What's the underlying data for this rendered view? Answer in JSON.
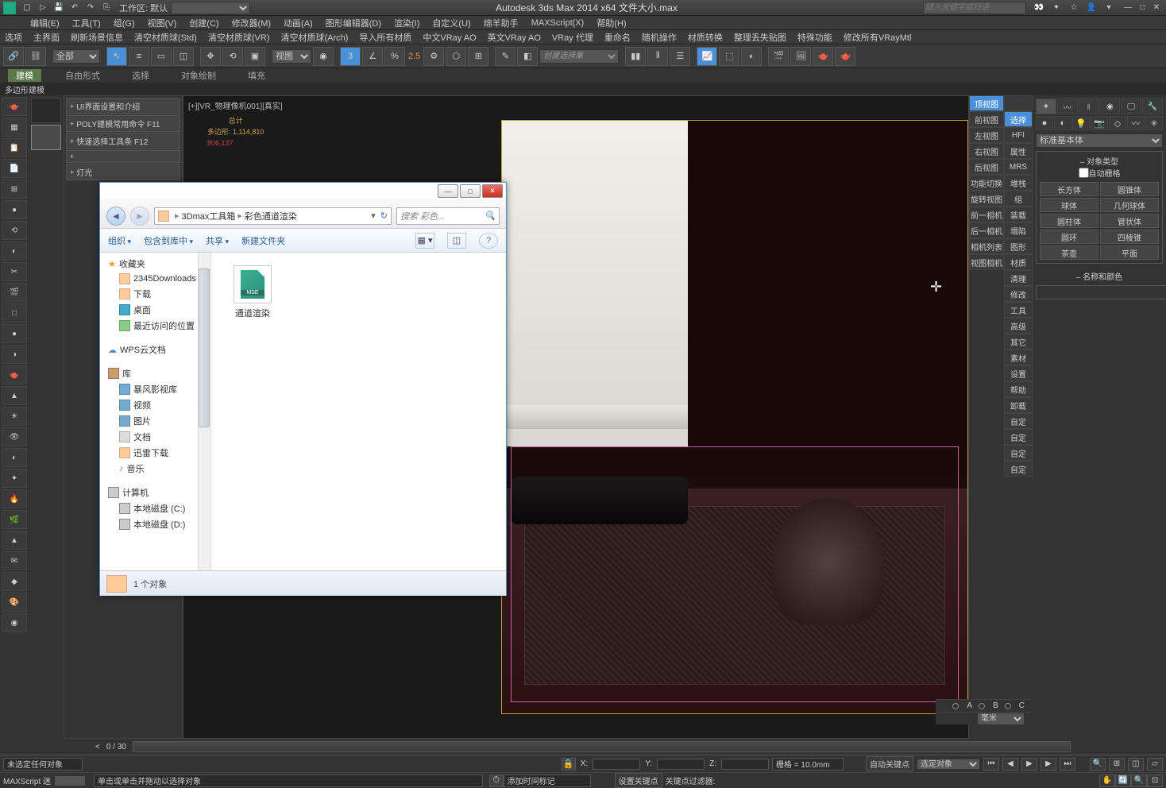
{
  "titlebar": {
    "workspace_label": "工作区: 默认",
    "app_title": "Autodesk 3ds Max  2014 x64   文件大小.max",
    "search_placeholder": "键入关键字或短语"
  },
  "menubar": [
    "编辑(E)",
    "工具(T)",
    "组(G)",
    "视图(V)",
    "创建(C)",
    "修改器(M)",
    "动画(A)",
    "图形编辑器(D)",
    "渲染(I)",
    "自定义(U)",
    "绵羊助手",
    "MAXScript(X)",
    "帮助(H)"
  ],
  "menubar2": [
    "选项",
    "主界面",
    "刷新场景信息",
    "清空材质球(Std)",
    "清空材质球(VR)",
    "清空材质球(Arch)",
    "导入所有材质",
    "中文VRay AO",
    "英文VRay AO",
    "VRay 代理",
    "重命名",
    "随机操作",
    "材质转换",
    "整理丢失贴图",
    "特殊功能",
    "修改所有VRayMtl"
  ],
  "toolbar": {
    "scope": "全部",
    "view_label": "视图",
    "num_label": "2.5",
    "create_set": "创建选择集"
  },
  "tabs": {
    "active": "建模",
    "items": [
      "建模",
      "自由形式",
      "选择",
      "对象绘制",
      "填充"
    ]
  },
  "subtab": "多边形建模",
  "command_buttons": [
    "UI界面设置和介绍",
    "POLY建模常用命令 F11",
    "快速选择工具条 F12",
    "",
    "灯光"
  ],
  "viewport": {
    "label": "[+][VR_物理像机001][真实]",
    "stats_title": "总计",
    "poly_label": "多边形:",
    "poly_count": "1,114,810",
    "vert_count": "806,137"
  },
  "right_labels": [
    {
      "main": "顶视图",
      "sub": ""
    },
    {
      "main": "前视图",
      "sub": "选择"
    },
    {
      "main": "左视图",
      "sub": "HFI"
    },
    {
      "main": "右视图",
      "sub": "属性"
    },
    {
      "main": "后视图",
      "sub": "MRS"
    },
    {
      "main": "功能切换",
      "sub": "堆栈"
    },
    {
      "main": "旋转视图",
      "sub": "组"
    },
    {
      "main": "前一相机",
      "sub": "装载"
    },
    {
      "main": "后一相机",
      "sub": "塌陷"
    },
    {
      "main": "相机列表",
      "sub": "图形"
    },
    {
      "main": "视图相机",
      "sub": "材质"
    }
  ],
  "right_extra": [
    "清理",
    "修改",
    "工具",
    "高级",
    "其它",
    "素材",
    "设置",
    "帮助",
    "卸载",
    "自定",
    "自定",
    "自定",
    "自定"
  ],
  "right_panel": {
    "dropdown": "标准基本体",
    "section1_title": "对象类型",
    "autogrid": "自动栅格",
    "primitives": [
      "长方体",
      "圆锥体",
      "球体",
      "几何球体",
      "圆柱体",
      "管状体",
      "圆环",
      "四棱锥",
      "茶壶",
      "平面"
    ],
    "section2_title": "名称和颜色"
  },
  "timeline": {
    "frame": "0 / 30"
  },
  "abc": {
    "a": "A",
    "b": "B",
    "c": "C"
  },
  "unit": "毫米",
  "status1": {
    "none_selected": "未选定任何对象",
    "x": "X:",
    "y": "Y:",
    "z": "Z:",
    "grid": "栅格 = 10.0mm",
    "autokey": "自动关键点",
    "filter": "选定对象"
  },
  "status2": {
    "maxscript": "MAXScript 迷",
    "prompt": "单击或单击并拖动以选择对象",
    "add_marker": "添加时间标记",
    "set_key": "设置关键点",
    "key_filter": "关键点过滤器:"
  },
  "dialog": {
    "breadcrumb": {
      "root": "3Dmax工具箱",
      "current": "彩色通道渲染"
    },
    "refresh": "↻",
    "search_placeholder": "搜索 彩色...",
    "toolbar": {
      "organize": "组织",
      "include": "包含到库中",
      "share": "共享",
      "newfolder": "新建文件夹"
    },
    "sidebar": {
      "favorites": "收藏夹",
      "fav_items": [
        "2345Downloads",
        "下载",
        "桌面",
        "最近访问的位置"
      ],
      "wps": "WPS云文档",
      "libraries": "库",
      "lib_items": [
        "暴风影视库",
        "视频",
        "图片",
        "文档",
        "迅雷下载",
        "音乐"
      ],
      "computer": "计算机",
      "drives": [
        "本地磁盘 (C:)",
        "本地磁盘 (D:)"
      ]
    },
    "file": {
      "name": "通道渲染",
      "ext": "MSE"
    },
    "footer": "1 个对象"
  }
}
